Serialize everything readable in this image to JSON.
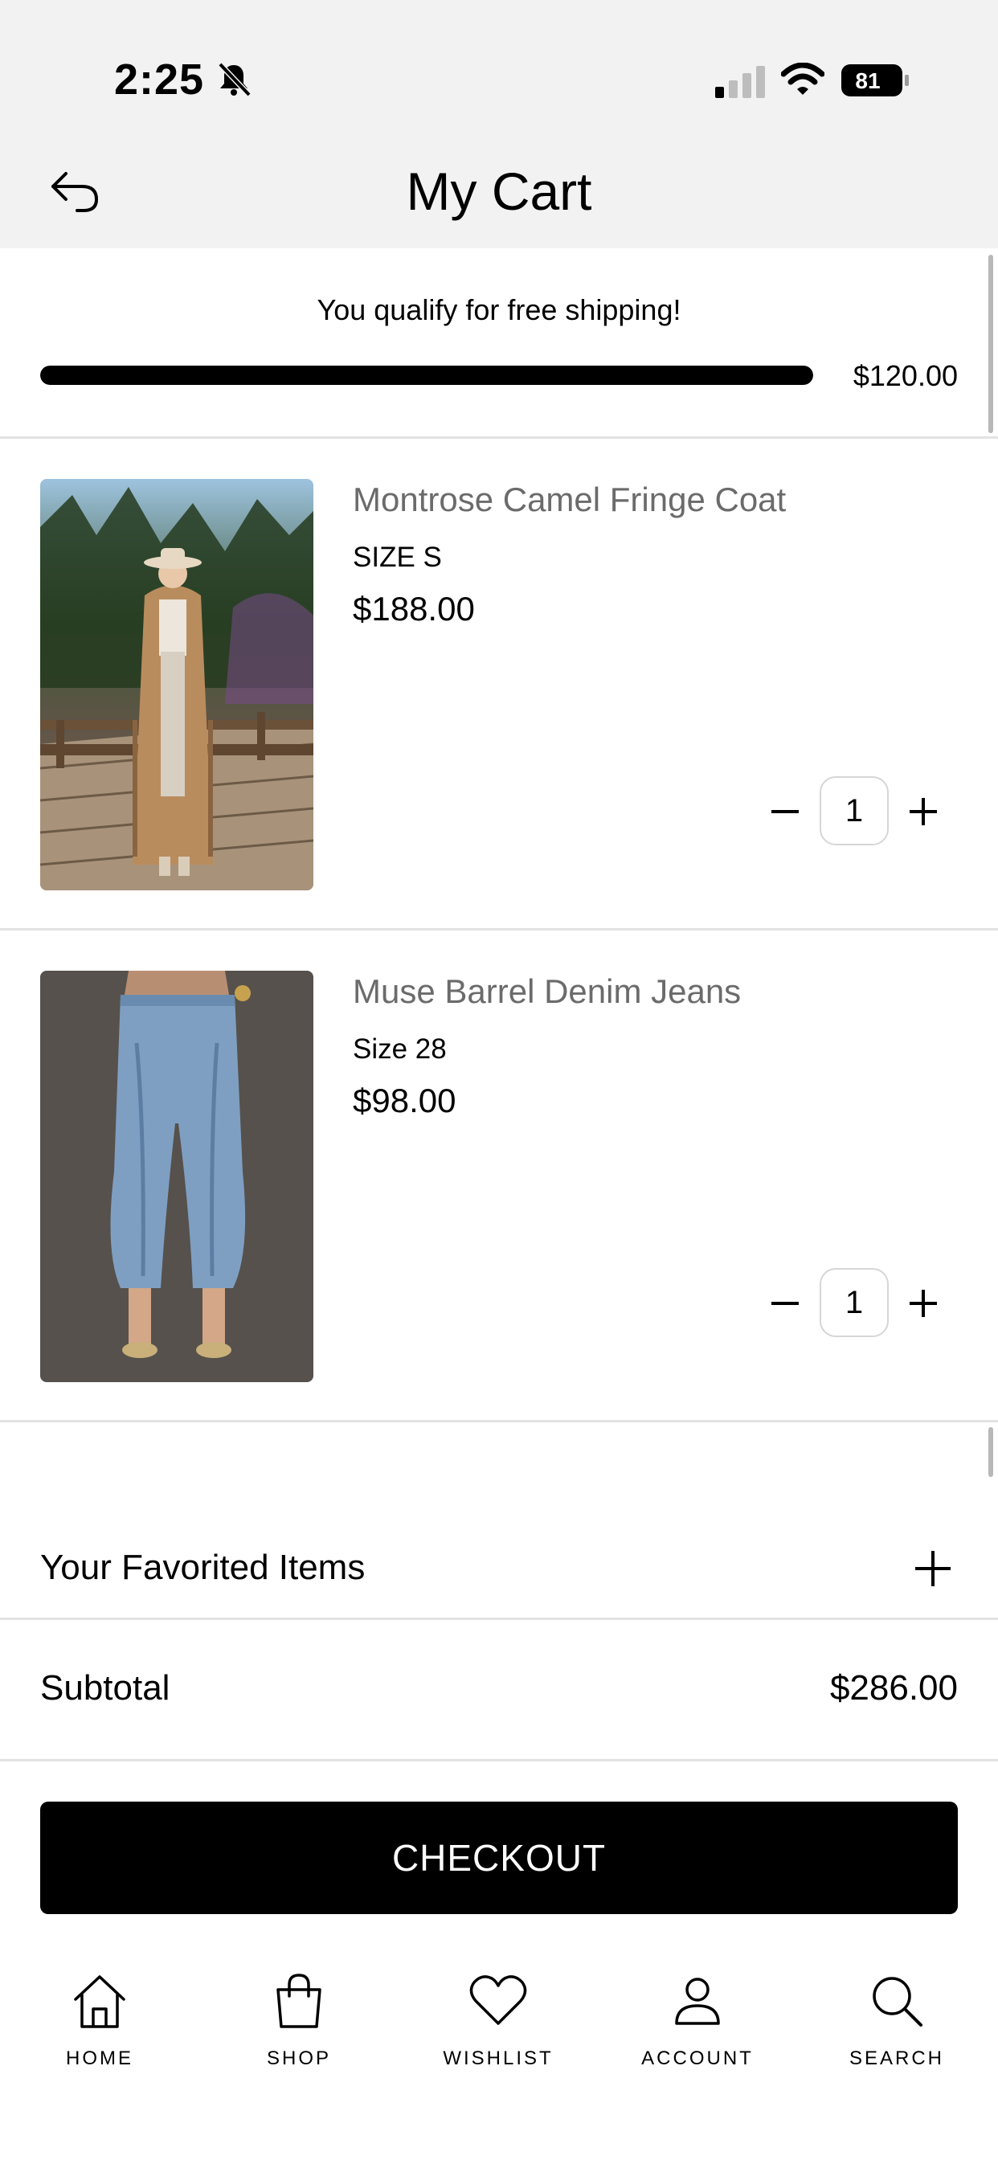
{
  "status_bar": {
    "time": "2:25",
    "battery": "81"
  },
  "header": {
    "title": "My Cart"
  },
  "shipping": {
    "message": "You qualify for free shipping!",
    "amount": "$120.00",
    "progress": 1.0
  },
  "cart": {
    "items": [
      {
        "name": "Montrose Camel Fringe Coat",
        "size": "SIZE S",
        "price": "$188.00",
        "quantity": "1"
      },
      {
        "name": "Muse Barrel Denim Jeans",
        "size": "Size 28",
        "price": "$98.00",
        "quantity": "1"
      }
    ]
  },
  "favorites": {
    "label": "Your Favorited Items"
  },
  "summary": {
    "subtotal_label": "Subtotal",
    "subtotal_value": "$286.00"
  },
  "checkout": {
    "label": "CHECKOUT"
  },
  "nav": {
    "items": [
      {
        "label": "HOME",
        "icon": "home-icon"
      },
      {
        "label": "SHOP",
        "icon": "shopping-bag-icon"
      },
      {
        "label": "WISHLIST",
        "icon": "heart-icon"
      },
      {
        "label": "ACCOUNT",
        "icon": "user-icon"
      },
      {
        "label": "SEARCH",
        "icon": "search-icon"
      }
    ]
  },
  "colors": {
    "background": "#ffffff",
    "header_bg": "#f2f2f2",
    "accent": "#000000",
    "muted_text": "#6b6b6b",
    "divider": "#e2e2e2"
  }
}
